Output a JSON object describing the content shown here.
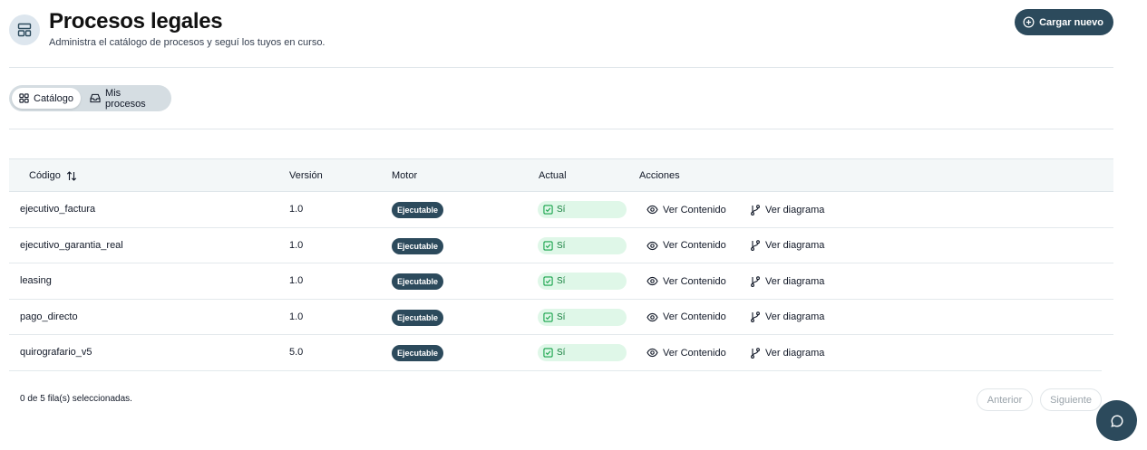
{
  "header": {
    "icon": "layout-icon",
    "title": "Procesos legales",
    "subtitle": "Administra el catálogo de procesos y seguí los tuyos en curso.",
    "upload_label": "Cargar nuevo",
    "upload_icon": "plus-circle-icon"
  },
  "view_toggle": {
    "items": [
      {
        "label": "Catálogo",
        "icon": "grid-icon",
        "active": true
      },
      {
        "label": "Mis procesos",
        "icon": "inbox-icon",
        "active": false
      }
    ]
  },
  "table": {
    "columns": {
      "code": "Código",
      "version": "Versión",
      "engine": "Motor",
      "current": "Actual",
      "actions": "Acciones"
    },
    "rows": [
      {
        "code": "ejecutivo_factura",
        "version": "1.0",
        "engine": "Ejecutable",
        "current": "Sí",
        "view_content": "Ver Contenido",
        "view_diagram": "Ver diagrama"
      },
      {
        "code": "ejecutivo_garantia_real",
        "version": "1.0",
        "engine": "Ejecutable",
        "current": "Sí",
        "view_content": "Ver Contenido",
        "view_diagram": "Ver diagrama"
      },
      {
        "code": "leasing",
        "version": "1.0",
        "engine": "Ejecutable",
        "current": "Sí",
        "view_content": "Ver Contenido",
        "view_diagram": "Ver diagrama"
      },
      {
        "code": "pago_directo",
        "version": "1.0",
        "engine": "Ejecutable",
        "current": "Sí",
        "view_content": "Ver Contenido",
        "view_diagram": "Ver diagrama"
      },
      {
        "code": "quirografario_v5",
        "version": "5.0",
        "engine": "Ejecutable",
        "current": "Sí",
        "view_content": "Ver Contenido",
        "view_diagram": "Ver diagrama"
      }
    ]
  },
  "footer": {
    "selection": "0 de 5 fila(s) seleccionadas.",
    "prev_label": "Anterior",
    "next_label": "Siguiente"
  },
  "colors": {
    "primary": "#2c4a5c",
    "success_bg": "#dff7e8",
    "success_text": "#15803d"
  }
}
